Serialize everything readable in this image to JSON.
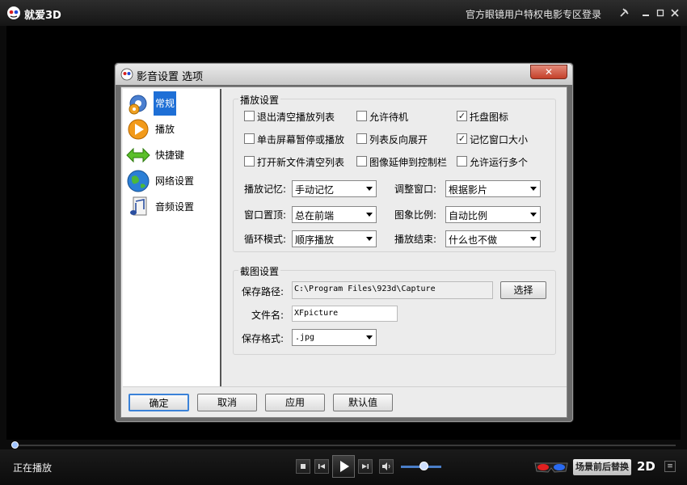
{
  "app": {
    "title": "就爱3D",
    "promo_link": "官方眼镜用户特权电影专区",
    "login": "登录",
    "pin_icon": "pin-icon",
    "min_icon": "minimize-icon",
    "max_icon": "maximize-icon",
    "close_icon": "close-icon"
  },
  "dialog": {
    "title": "影音设置 选项",
    "close_label": "✕",
    "nav": [
      {
        "label": "常规",
        "icon": "gear-icon",
        "active": true
      },
      {
        "label": "播放",
        "icon": "play-icon",
        "active": false
      },
      {
        "label": "快捷键",
        "icon": "arrows-icon",
        "active": false
      },
      {
        "label": "网络设置",
        "icon": "globe-icon",
        "active": false
      },
      {
        "label": "音频设置",
        "icon": "music-icon",
        "active": false
      }
    ],
    "play_group": {
      "title": "播放设置",
      "checkboxes": [
        {
          "label": "退出清空播放列表",
          "checked": false
        },
        {
          "label": "允许待机",
          "checked": false
        },
        {
          "label": "托盘图标",
          "checked": true
        },
        {
          "label": "单击屏幕暂停或播放",
          "checked": false
        },
        {
          "label": "列表反向展开",
          "checked": false
        },
        {
          "label": "记忆窗口大小",
          "checked": true
        },
        {
          "label": "打开新文件清空列表",
          "checked": false
        },
        {
          "label": "图像延伸到控制栏",
          "checked": false
        },
        {
          "label": "允许运行多个",
          "checked": false
        }
      ],
      "selects": [
        {
          "label": "播放记忆:",
          "value": "手动记忆"
        },
        {
          "label": "调整窗口:",
          "value": "根据影片"
        },
        {
          "label": "窗口置顶:",
          "value": "总在前端"
        },
        {
          "label": "图象比例:",
          "value": "自动比例"
        },
        {
          "label": "循环模式:",
          "value": "顺序播放"
        },
        {
          "label": "播放结束:",
          "value": "什么也不做"
        }
      ]
    },
    "capture_group": {
      "title": "截图设置",
      "path_label": "保存路径:",
      "path_value": "C:\\Program Files\\923d\\Capture",
      "browse_label": "选择",
      "filename_label": "文件名:",
      "filename_value": "XFpicture",
      "format_label": "保存格式:",
      "format_value": ".jpg"
    },
    "buttons": {
      "ok": "确定",
      "cancel": "取消",
      "apply": "应用",
      "default": "默认值"
    }
  },
  "player": {
    "status": "正在播放",
    "stop_icon": "stop-icon",
    "prev_icon": "prev-icon",
    "play_icon": "play-icon",
    "next_icon": "next-icon",
    "volume_icon": "volume-icon",
    "volume_level": 0.55,
    "seek_position": 0.0,
    "scene_label": "场景前后替换",
    "mode_label": "2D",
    "menu_icon": "menu-icon",
    "glasses_icon": "3d-glasses-icon"
  }
}
